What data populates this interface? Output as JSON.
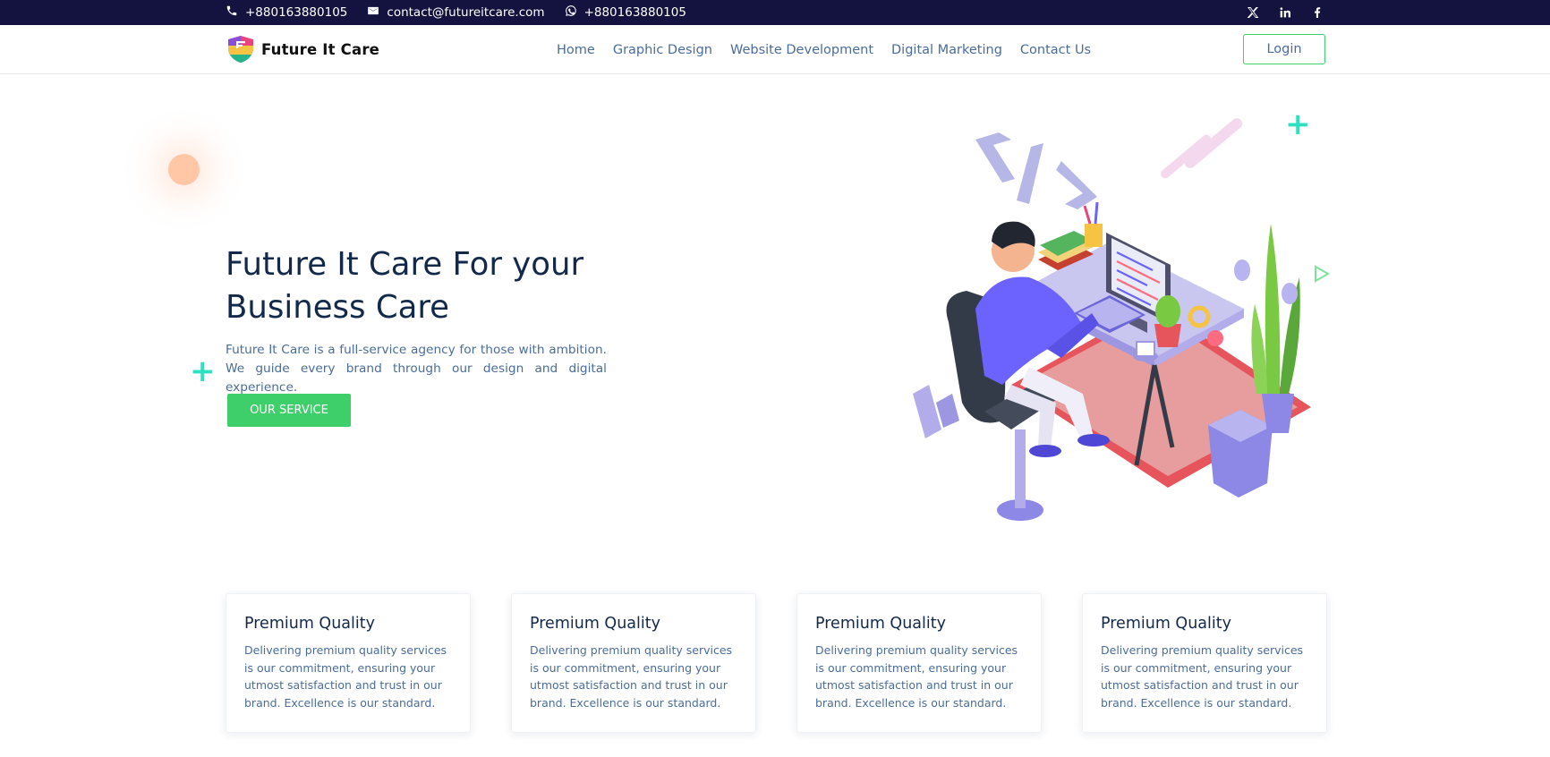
{
  "topbar": {
    "phone": "+880163880105",
    "email": "contact@futureitcare.com",
    "whatsapp": "+880163880105",
    "icons": [
      "phone-icon",
      "mail-icon",
      "whatsapp-icon"
    ],
    "social": [
      "x-icon",
      "linkedin-icon",
      "facebook-icon"
    ]
  },
  "navbar": {
    "brand": "Future It Care",
    "links": [
      "Home",
      "Graphic Design",
      "Website Development",
      "Digital Marketing",
      "Contact Us"
    ],
    "login": "Login"
  },
  "hero": {
    "title": "Future It Care For your Business Care",
    "description": "Future It Care is a full-service agency for those with ambition. We guide every brand through our design and digital experience.",
    "cta": "OUR SERVICE"
  },
  "cards": [
    {
      "title": "Premium Quality",
      "text": "Delivering premium quality services is our commitment, ensuring your utmost satisfaction and trust in our brand. Excellence is our standard."
    },
    {
      "title": "Premium Quality",
      "text": "Delivering premium quality services is our commitment, ensuring your utmost satisfaction and trust in our brand. Excellence is our standard."
    },
    {
      "title": "Premium Quality",
      "text": "Delivering premium quality services is our commitment, ensuring your utmost satisfaction and trust in our brand. Excellence is our standard."
    },
    {
      "title": "Premium Quality",
      "text": "Delivering premium quality services is our commitment, ensuring your utmost satisfaction and trust in our brand. Excellence is our standard."
    }
  ],
  "colors": {
    "topbar_bg": "#141340",
    "accent_green": "#3fcf6a",
    "heading": "#13294b",
    "body_text": "#4a6d9a",
    "plus_teal": "#2fe0c0"
  }
}
